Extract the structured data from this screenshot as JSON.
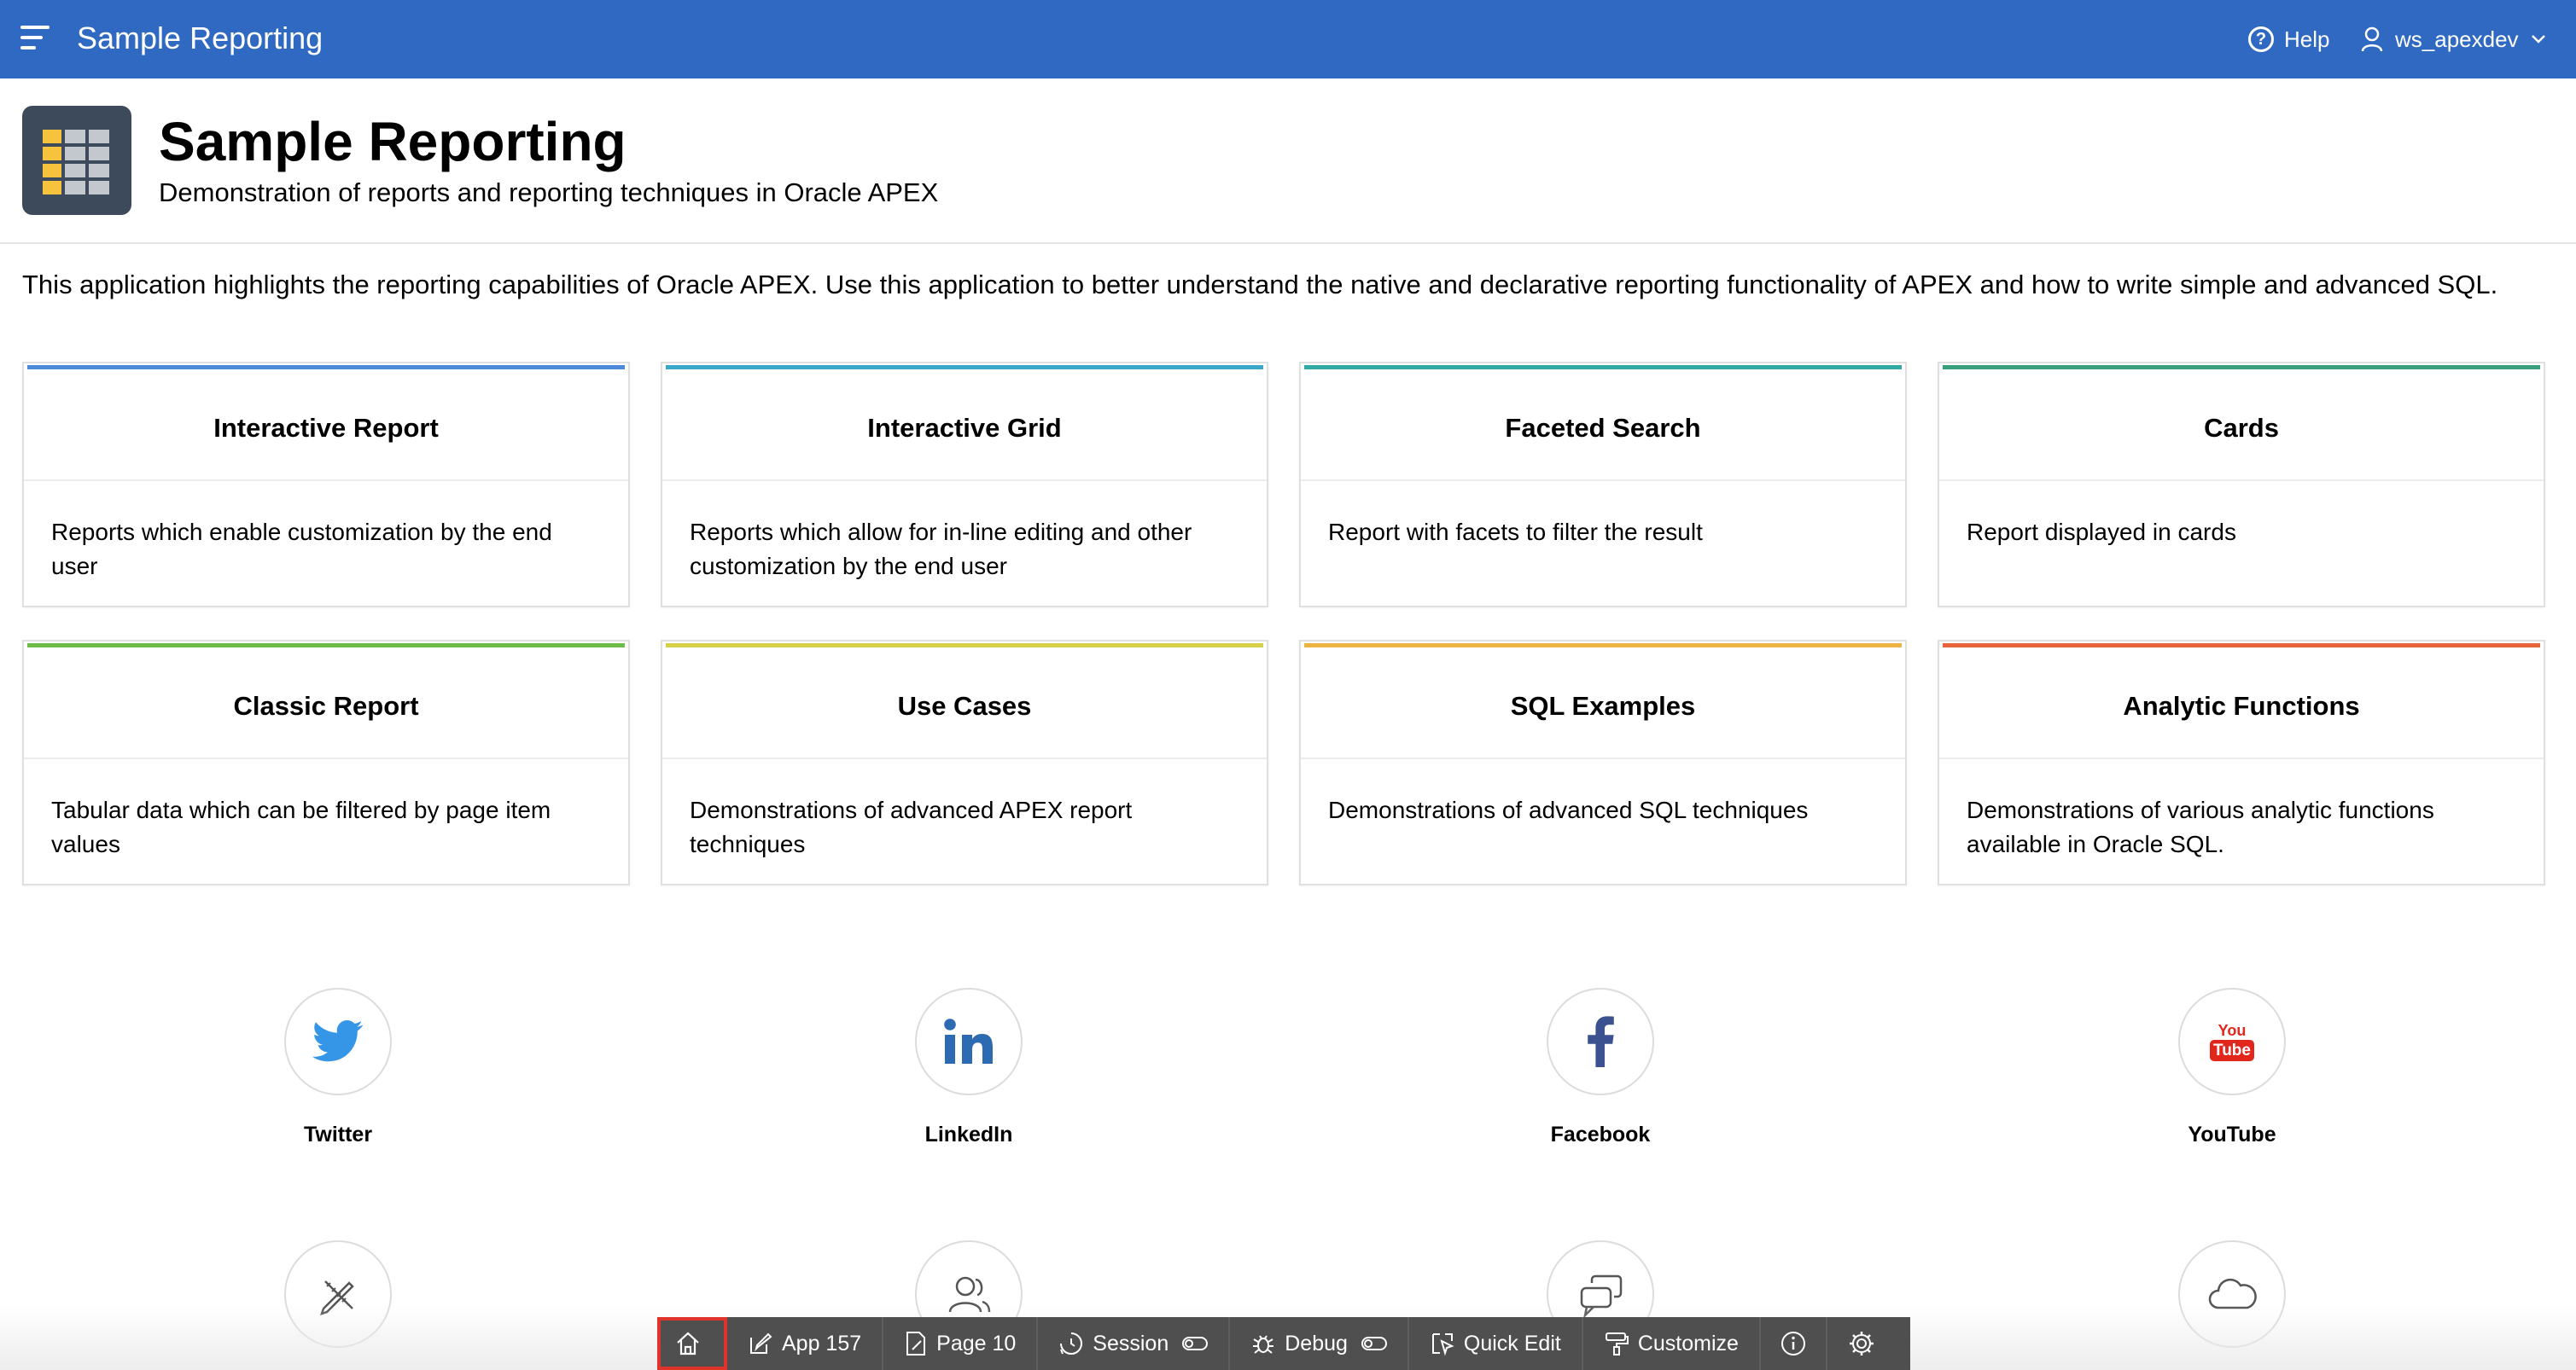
{
  "header": {
    "app_title": "Sample Reporting",
    "help_label": "Help",
    "user_label": "ws_apexdev"
  },
  "hero": {
    "title": "Sample Reporting",
    "subtitle": "Demonstration of reports and reporting techniques in Oracle APEX"
  },
  "intro": "This application highlights the reporting capabilities of Oracle APEX. Use this application to better understand the native and declarative reporting functionality of APEX and how to write simple and advanced SQL.",
  "cards": [
    {
      "title": "Interactive Report",
      "desc": "Reports which enable customization by the end user",
      "accent": "#4a8ad8"
    },
    {
      "title": "Interactive Grid",
      "desc": "Reports which allow for in-line editing and other customization by the end user",
      "accent": "#3aa7c8"
    },
    {
      "title": "Faceted Search",
      "desc": "Report with facets to filter the result",
      "accent": "#33a9a5"
    },
    {
      "title": "Cards",
      "desc": "Report displayed in cards",
      "accent": "#3a9f7c"
    },
    {
      "title": "Classic Report",
      "desc": "Tabular data which can be filtered by page item values",
      "accent": "#6fbb4a"
    },
    {
      "title": "Use Cases",
      "desc": "Demonstrations of advanced APEX report techniques",
      "accent": "#d6cf4a"
    },
    {
      "title": "SQL Examples",
      "desc": "Demonstrations of advanced SQL techniques",
      "accent": "#efb444"
    },
    {
      "title": "Analytic Functions",
      "desc": "Demonstrations of various analytic functions available in Oracle SQL.",
      "accent": "#e8643a"
    }
  ],
  "social": [
    {
      "label": "Twitter",
      "icon": "twitter-icon"
    },
    {
      "label": "LinkedIn",
      "icon": "linkedin-icon"
    },
    {
      "label": "Facebook",
      "icon": "facebook-icon"
    },
    {
      "label": "YouTube",
      "icon": "youtube-icon"
    }
  ],
  "row2_icons": [
    "pencil-ruler-icon",
    "users-icon",
    "chat-icon",
    "cloud-icon"
  ],
  "youtube_logo": {
    "top": "You",
    "bottom": "Tube"
  },
  "devbar": {
    "app": "App 157",
    "page": "Page 10",
    "session": "Session",
    "debug": "Debug",
    "quick_edit": "Quick Edit",
    "customize": "Customize"
  },
  "colors": {
    "header": "#3069c1",
    "twitter": "#3596e8",
    "linkedin": "#2c6bb2",
    "facebook": "#3c5190",
    "youtube": "#e1261c",
    "devbar": "#4f4f4f",
    "home_highlight": "#e0332c"
  }
}
